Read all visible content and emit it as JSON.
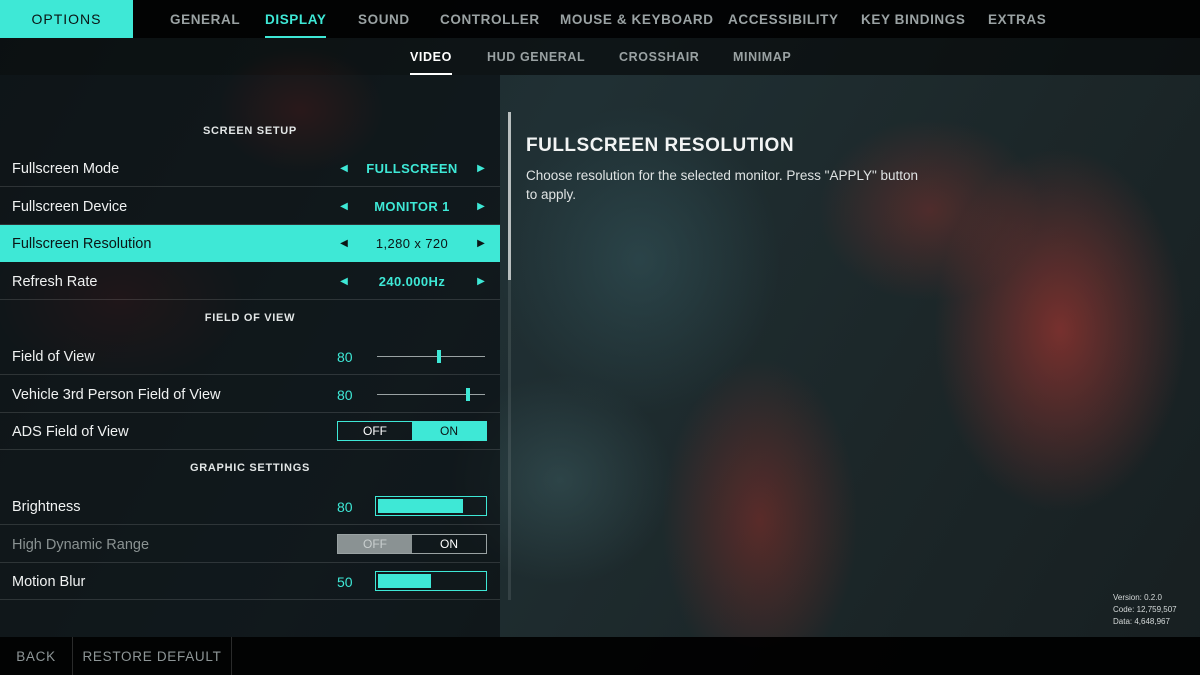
{
  "accent_color": "#3ee8d6",
  "header": {
    "options_label": "OPTIONS",
    "tabs": [
      {
        "label": "GENERAL",
        "active": false
      },
      {
        "label": "DISPLAY",
        "active": true
      },
      {
        "label": "SOUND",
        "active": false
      },
      {
        "label": "CONTROLLER",
        "active": false
      },
      {
        "label": "MOUSE & KEYBOARD",
        "active": false
      },
      {
        "label": "ACCESSIBILITY",
        "active": false
      },
      {
        "label": "KEY BINDINGS",
        "active": false
      },
      {
        "label": "EXTRAS",
        "active": false
      }
    ],
    "subtabs": [
      {
        "label": "VIDEO",
        "active": true
      },
      {
        "label": "HUD GENERAL",
        "active": false
      },
      {
        "label": "CROSSHAIR",
        "active": false
      },
      {
        "label": "MINIMAP",
        "active": false
      }
    ]
  },
  "settings": {
    "screen_setup": {
      "header": "SCREEN SETUP",
      "fullscreen_mode": {
        "label": "Fullscreen Mode",
        "value": "FULLSCREEN"
      },
      "fullscreen_device": {
        "label": "Fullscreen Device",
        "value": "MONITOR 1"
      },
      "fullscreen_resolution": {
        "label": "Fullscreen Resolution",
        "value": "1,280 x 720",
        "selected": true
      },
      "refresh_rate": {
        "label": "Refresh Rate",
        "value": "240.000Hz"
      }
    },
    "field_of_view": {
      "header": "FIELD OF VIEW",
      "fov": {
        "label": "Field of View",
        "value": "80",
        "level": 0.57
      },
      "vehicle_fov": {
        "label": "Vehicle 3rd Person Field of View",
        "value": "80",
        "level": 0.84
      },
      "ads_fov": {
        "label": "ADS Field of View",
        "off_label": "OFF",
        "on_label": "ON",
        "state": "ON"
      }
    },
    "graphic_settings": {
      "header": "GRAPHIC SETTINGS",
      "brightness": {
        "label": "Brightness",
        "value": "80",
        "level": 0.8
      },
      "hdr": {
        "label": "High Dynamic Range",
        "off_label": "OFF",
        "on_label": "ON",
        "state": "OFF",
        "disabled": true
      },
      "motion_blur": {
        "label": "Motion Blur",
        "value": "50",
        "level": 0.5
      }
    }
  },
  "detail": {
    "title": "FULLSCREEN RESOLUTION",
    "description": "Choose resolution for the selected monitor. Press \"APPLY\" button to apply."
  },
  "version_info": {
    "version": "Version: 0.2.0",
    "code": "Code: 12,759,507",
    "data": "Data: 4,648,967"
  },
  "footer": {
    "back_label": "BACK",
    "restore_label": "RESTORE DEFAULT"
  }
}
